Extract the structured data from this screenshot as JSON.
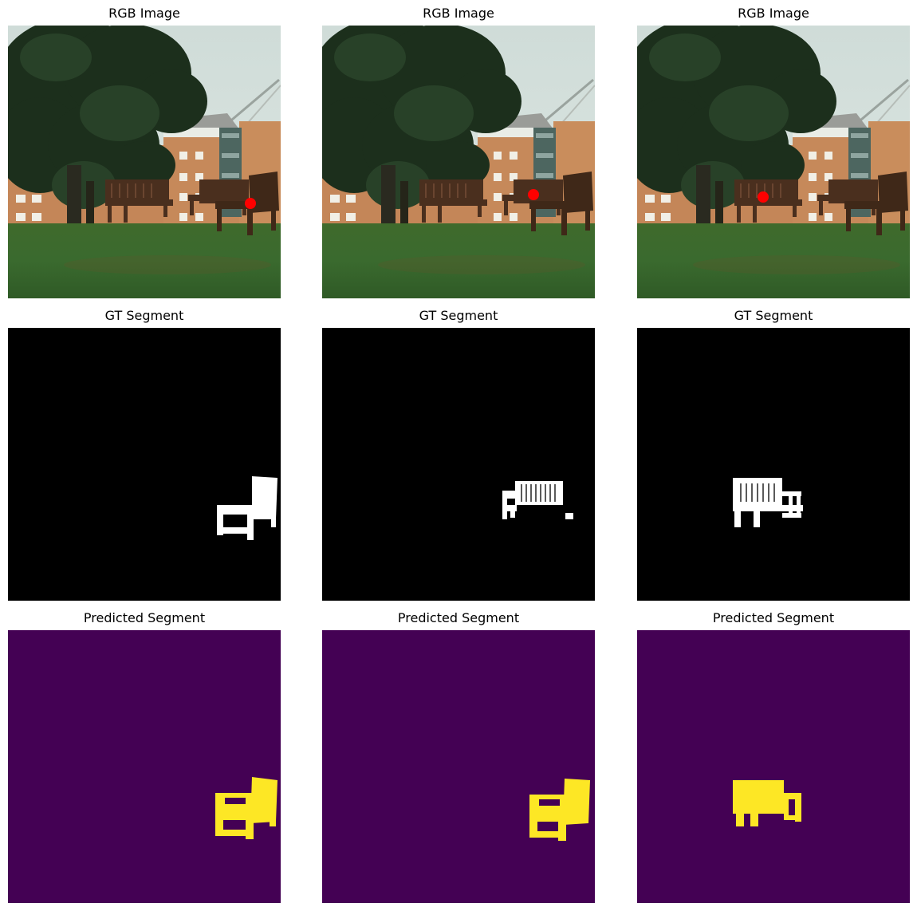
{
  "figure": {
    "rows": [
      {
        "row": "rgb",
        "titles": [
          "RGB Image",
          "RGB Image",
          "RGB Image"
        ]
      },
      {
        "row": "gt",
        "titles": [
          "GT Segment",
          "GT Segment",
          "GT Segment"
        ]
      },
      {
        "row": "pred",
        "titles": [
          "Predicted Segment",
          "Predicted Segment",
          "Predicted Segment"
        ]
      }
    ]
  },
  "colors": {
    "click_marker": "#ff0000",
    "gt_background": "#000000",
    "gt_mask": "#ffffff",
    "pred_background": "#440154",
    "pred_mask": "#fde725"
  }
}
